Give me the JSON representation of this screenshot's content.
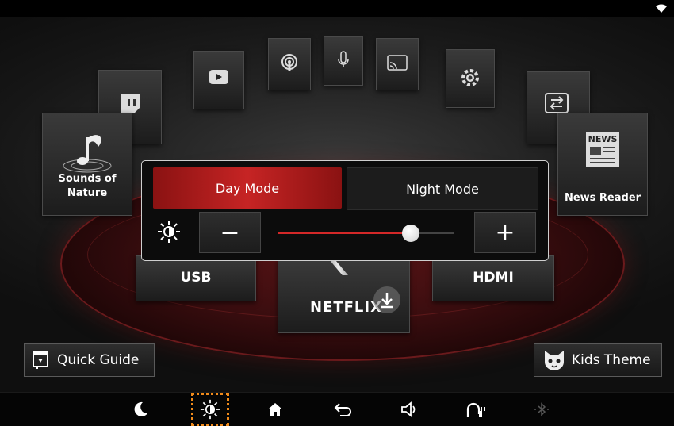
{
  "apps": {
    "sounds_of_nature": "Sounds of\nNature",
    "news_reader": "News Reader",
    "news_badge": "NEWS",
    "usb": "USB",
    "hdmi": "HDMI",
    "netflix": "NETFLIX"
  },
  "popup": {
    "day_mode": "Day Mode",
    "night_mode": "Night Mode",
    "minus": "−",
    "plus": "+",
    "brightness_level": 0.75
  },
  "corner": {
    "quick_guide": "Quick Guide",
    "kids_theme": "Kids Theme"
  },
  "colors": {
    "accent_red": "#c62424",
    "focus_orange": "#f08a1a"
  },
  "icons": [
    "wifi-icon",
    "youtube-icon",
    "podcast-icon",
    "mic-icon",
    "cast-icon",
    "settings-icon",
    "twitch-icon",
    "switch-icon",
    "music-note-icon",
    "news-icon",
    "netflix-download-icon",
    "moon-icon",
    "brightness-icon",
    "home-icon",
    "back-icon",
    "volume-icon",
    "android-auto-icon",
    "bluetooth-icon",
    "quick-guide-icon",
    "kids-theme-icon"
  ]
}
